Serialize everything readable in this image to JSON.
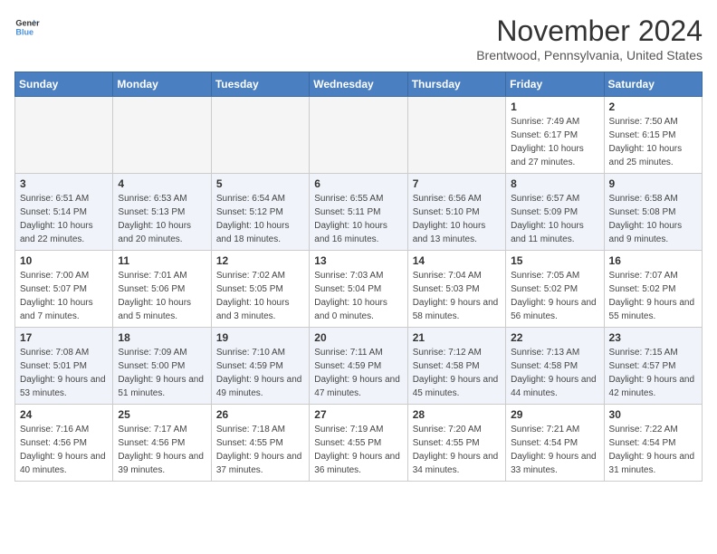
{
  "logo": {
    "line1": "General",
    "line2": "Blue"
  },
  "title": "November 2024",
  "location": "Brentwood, Pennsylvania, United States",
  "days_of_week": [
    "Sunday",
    "Monday",
    "Tuesday",
    "Wednesday",
    "Thursday",
    "Friday",
    "Saturday"
  ],
  "weeks": [
    [
      {
        "day": "",
        "detail": ""
      },
      {
        "day": "",
        "detail": ""
      },
      {
        "day": "",
        "detail": ""
      },
      {
        "day": "",
        "detail": ""
      },
      {
        "day": "",
        "detail": ""
      },
      {
        "day": "1",
        "detail": "Sunrise: 7:49 AM\nSunset: 6:17 PM\nDaylight: 10 hours and 27 minutes."
      },
      {
        "day": "2",
        "detail": "Sunrise: 7:50 AM\nSunset: 6:15 PM\nDaylight: 10 hours and 25 minutes."
      }
    ],
    [
      {
        "day": "3",
        "detail": "Sunrise: 6:51 AM\nSunset: 5:14 PM\nDaylight: 10 hours and 22 minutes."
      },
      {
        "day": "4",
        "detail": "Sunrise: 6:53 AM\nSunset: 5:13 PM\nDaylight: 10 hours and 20 minutes."
      },
      {
        "day": "5",
        "detail": "Sunrise: 6:54 AM\nSunset: 5:12 PM\nDaylight: 10 hours and 18 minutes."
      },
      {
        "day": "6",
        "detail": "Sunrise: 6:55 AM\nSunset: 5:11 PM\nDaylight: 10 hours and 16 minutes."
      },
      {
        "day": "7",
        "detail": "Sunrise: 6:56 AM\nSunset: 5:10 PM\nDaylight: 10 hours and 13 minutes."
      },
      {
        "day": "8",
        "detail": "Sunrise: 6:57 AM\nSunset: 5:09 PM\nDaylight: 10 hours and 11 minutes."
      },
      {
        "day": "9",
        "detail": "Sunrise: 6:58 AM\nSunset: 5:08 PM\nDaylight: 10 hours and 9 minutes."
      }
    ],
    [
      {
        "day": "10",
        "detail": "Sunrise: 7:00 AM\nSunset: 5:07 PM\nDaylight: 10 hours and 7 minutes."
      },
      {
        "day": "11",
        "detail": "Sunrise: 7:01 AM\nSunset: 5:06 PM\nDaylight: 10 hours and 5 minutes."
      },
      {
        "day": "12",
        "detail": "Sunrise: 7:02 AM\nSunset: 5:05 PM\nDaylight: 10 hours and 3 minutes."
      },
      {
        "day": "13",
        "detail": "Sunrise: 7:03 AM\nSunset: 5:04 PM\nDaylight: 10 hours and 0 minutes."
      },
      {
        "day": "14",
        "detail": "Sunrise: 7:04 AM\nSunset: 5:03 PM\nDaylight: 9 hours and 58 minutes."
      },
      {
        "day": "15",
        "detail": "Sunrise: 7:05 AM\nSunset: 5:02 PM\nDaylight: 9 hours and 56 minutes."
      },
      {
        "day": "16",
        "detail": "Sunrise: 7:07 AM\nSunset: 5:02 PM\nDaylight: 9 hours and 55 minutes."
      }
    ],
    [
      {
        "day": "17",
        "detail": "Sunrise: 7:08 AM\nSunset: 5:01 PM\nDaylight: 9 hours and 53 minutes."
      },
      {
        "day": "18",
        "detail": "Sunrise: 7:09 AM\nSunset: 5:00 PM\nDaylight: 9 hours and 51 minutes."
      },
      {
        "day": "19",
        "detail": "Sunrise: 7:10 AM\nSunset: 4:59 PM\nDaylight: 9 hours and 49 minutes."
      },
      {
        "day": "20",
        "detail": "Sunrise: 7:11 AM\nSunset: 4:59 PM\nDaylight: 9 hours and 47 minutes."
      },
      {
        "day": "21",
        "detail": "Sunrise: 7:12 AM\nSunset: 4:58 PM\nDaylight: 9 hours and 45 minutes."
      },
      {
        "day": "22",
        "detail": "Sunrise: 7:13 AM\nSunset: 4:58 PM\nDaylight: 9 hours and 44 minutes."
      },
      {
        "day": "23",
        "detail": "Sunrise: 7:15 AM\nSunset: 4:57 PM\nDaylight: 9 hours and 42 minutes."
      }
    ],
    [
      {
        "day": "24",
        "detail": "Sunrise: 7:16 AM\nSunset: 4:56 PM\nDaylight: 9 hours and 40 minutes."
      },
      {
        "day": "25",
        "detail": "Sunrise: 7:17 AM\nSunset: 4:56 PM\nDaylight: 9 hours and 39 minutes."
      },
      {
        "day": "26",
        "detail": "Sunrise: 7:18 AM\nSunset: 4:55 PM\nDaylight: 9 hours and 37 minutes."
      },
      {
        "day": "27",
        "detail": "Sunrise: 7:19 AM\nSunset: 4:55 PM\nDaylight: 9 hours and 36 minutes."
      },
      {
        "day": "28",
        "detail": "Sunrise: 7:20 AM\nSunset: 4:55 PM\nDaylight: 9 hours and 34 minutes."
      },
      {
        "day": "29",
        "detail": "Sunrise: 7:21 AM\nSunset: 4:54 PM\nDaylight: 9 hours and 33 minutes."
      },
      {
        "day": "30",
        "detail": "Sunrise: 7:22 AM\nSunset: 4:54 PM\nDaylight: 9 hours and 31 minutes."
      }
    ]
  ]
}
